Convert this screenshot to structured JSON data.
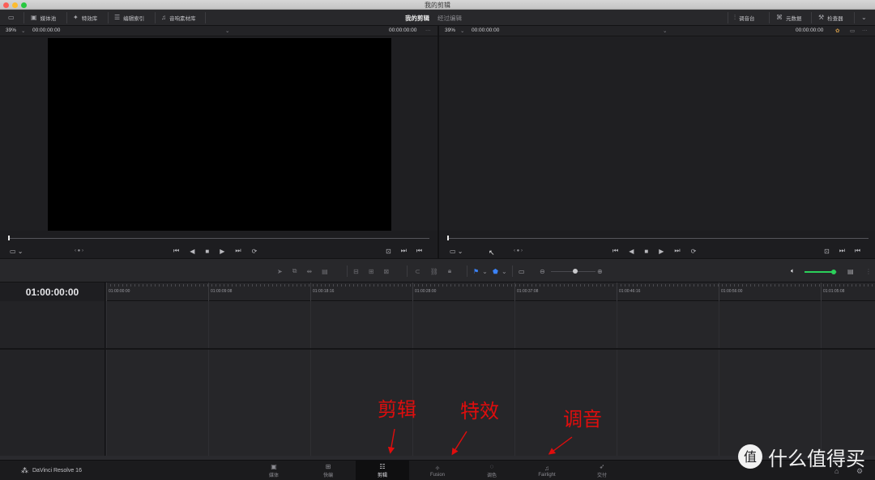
{
  "window": {
    "title": "我的剪辑"
  },
  "toolbar": {
    "media_pool": "媒体池",
    "effects": "特效库",
    "edit_index": "编辑索引",
    "sound_library": "音响素材库",
    "project_name": "我的剪辑",
    "project_state": "经过编辑",
    "mixer": "调音台",
    "metadata": "元数据",
    "inspector": "检查器"
  },
  "source_viewer": {
    "zoom": "39%",
    "timecode_left": "00:00:00:00",
    "timecode_right": "00:00:00:00"
  },
  "timeline_viewer": {
    "zoom": "39%",
    "timecode_left": "00:00:00:00",
    "timecode_right": "00:00:00:00"
  },
  "timeline": {
    "current_timecode": "01:00:00:00",
    "ruler_ticks": [
      "01:00:00:00",
      "01:00:09:08",
      "01:00:18:16",
      "01:00:28:00",
      "01:00:37:08",
      "01:00:46:16",
      "01:00:56:00",
      "01:01:05:08"
    ],
    "volume_level": 0.9
  },
  "pages": [
    {
      "label": "媒体",
      "icon": "media-icon"
    },
    {
      "label": "快编",
      "icon": "cut-icon"
    },
    {
      "label": "剪辑",
      "icon": "edit-icon",
      "active": true
    },
    {
      "label": "Fusion",
      "icon": "fusion-icon"
    },
    {
      "label": "调色",
      "icon": "color-icon"
    },
    {
      "label": "Fairlight",
      "icon": "fairlight-icon"
    },
    {
      "label": "交付",
      "icon": "deliver-icon"
    }
  ],
  "brand": {
    "name": "DaVinci Resolve 16"
  },
  "annotations": {
    "edit": "剪辑",
    "effects": "特效",
    "audio": "调音",
    "accent": "#e00d0d"
  },
  "watermark": {
    "text": "什么值得买"
  }
}
